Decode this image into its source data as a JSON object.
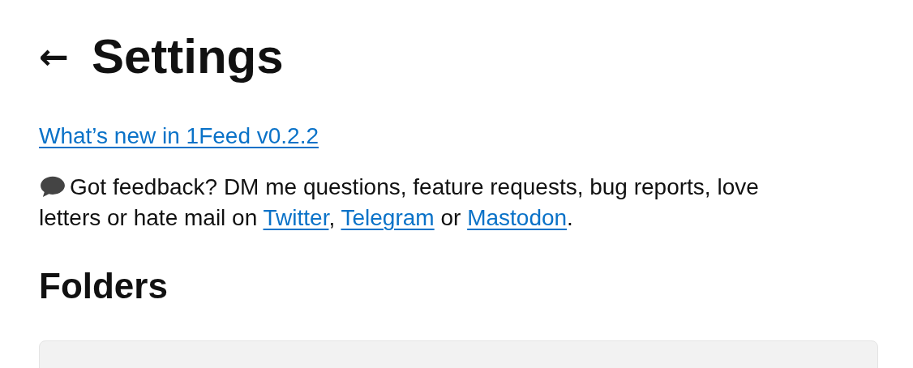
{
  "header": {
    "back": "←",
    "title": "Settings"
  },
  "whats_new_link": "What’s new in 1Feed v0.2.2",
  "feedback": [
    {
      "kind": "text",
      "text": "Got feedback? DM me questions, feature requests, bug reports, love letters or hate mail on "
    },
    {
      "kind": "link",
      "text": "Twitter"
    },
    {
      "kind": "text",
      "text": ", "
    },
    {
      "kind": "link",
      "text": "Telegram"
    },
    {
      "kind": "text",
      "text": " or "
    },
    {
      "kind": "link",
      "text": "Mastodon"
    },
    {
      "kind": "text",
      "text": "."
    }
  ],
  "folders": {
    "heading": "Folders"
  }
}
